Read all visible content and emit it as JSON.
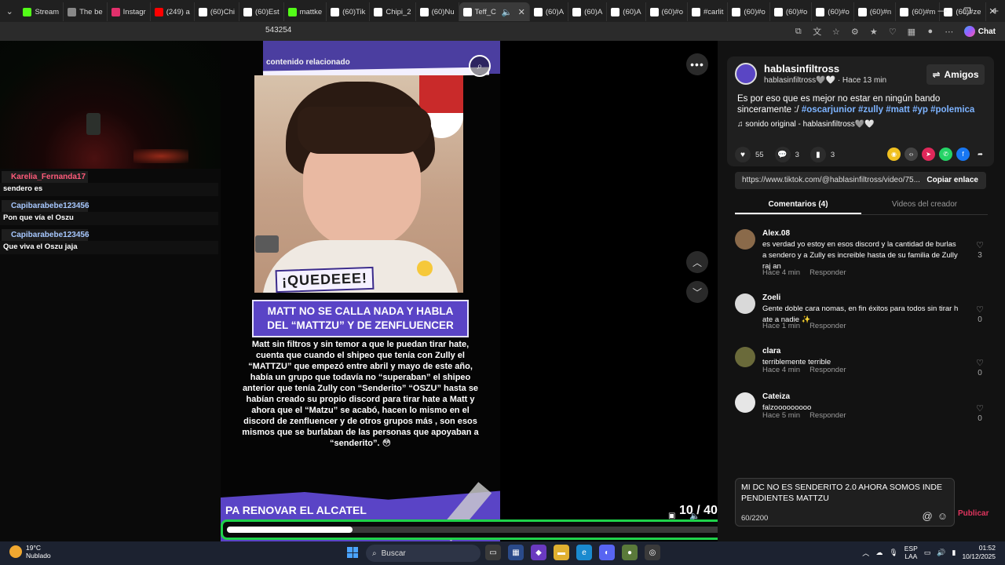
{
  "browser": {
    "tabs": [
      {
        "label": "Stream",
        "color": "#53fc18",
        "active": false
      },
      {
        "label": "The be",
        "color": "#888888",
        "active": false
      },
      {
        "label": "Instagr",
        "color": "#e1306c",
        "active": false
      },
      {
        "label": "(249) a",
        "color": "#ff0000",
        "active": false
      },
      {
        "label": "(60)Chi",
        "color": "#ffffff",
        "active": false
      },
      {
        "label": "(60)Est",
        "color": "#ffffff",
        "active": false
      },
      {
        "label": "mattke",
        "color": "#53fc18",
        "active": false
      },
      {
        "label": "(60)Tik",
        "color": "#ffffff",
        "active": false
      },
      {
        "label": "Chipi_2",
        "color": "#ffffff",
        "active": false
      },
      {
        "label": "(60)Nu",
        "color": "#ffffff",
        "active": false
      },
      {
        "label": "Teff_C",
        "color": "#ffffff",
        "active": true
      },
      {
        "label": "(60)A",
        "color": "#ffffff",
        "active": false
      },
      {
        "label": "(60)A",
        "color": "#ffffff",
        "active": false
      },
      {
        "label": "(60)A",
        "color": "#ffffff",
        "active": false
      },
      {
        "label": "(60)#o",
        "color": "#ffffff",
        "active": false
      },
      {
        "label": "#carlit",
        "color": "#ffffff",
        "active": false
      },
      {
        "label": "(60)#o",
        "color": "#ffffff",
        "active": false
      },
      {
        "label": "(60)#o",
        "color": "#ffffff",
        "active": false
      },
      {
        "label": "(60)#o",
        "color": "#ffffff",
        "active": false
      },
      {
        "label": "(60)#n",
        "color": "#ffffff",
        "active": false
      },
      {
        "label": "(60)#m",
        "color": "#ffffff",
        "active": false
      },
      {
        "label": "(60)#ze",
        "color": "#ffffff",
        "active": false
      }
    ],
    "new_tab": "+",
    "url_fragment": "543254",
    "chat_label": "Chat"
  },
  "stream_chat": {
    "messages": [
      {
        "user": "Karelia_Fernanda17",
        "user_color": "#ff5b7a",
        "text": "sendero es"
      },
      {
        "user": "Capibarabebe123456",
        "user_color": "#a7c8ff",
        "text": "Pon que vía el Oszu"
      },
      {
        "user": "Capibarabebe123456",
        "user_color": "#a7c8ff",
        "text": "Que viva el Oszu jaja"
      }
    ]
  },
  "video": {
    "related_label": "contenido relacionado",
    "sticker_text": "¡QUEDEEE!",
    "headline": "MATT NO SE CALLA NADA Y HABLA DEL “MATTZU” Y DE ZENFLUENCER",
    "body": "Matt sin filtros y sin temor a que le puedan tirar hate, cuenta que cuando el shipeo que tenía con Zully el “MATTZU” que empezó entre abril y mayo de este año, había un grupo que todavía no “superaban” el shipeo anterior que tenía Zully con “Senderito” “OSZU” hasta se habían creado su propio discord para tirar hate a Matt y ahora que el “Matzu” se acabó, hacen lo mismo en el discord de zenfluencer y de otros grupos más , son esos mismos que se burlaban de las personas que apoyaban a “senderito”. 😳",
    "bottom_text": "PA RENOVAR EL ALCATEL",
    "counter": "10 / 40",
    "progress": 0.25
  },
  "post": {
    "creator": "hablasinfiltross",
    "creator_sub": "hablasinfiltross🩶🤍 · Hace 13 min",
    "friends_button": "Amigos",
    "description": "Es por eso que es mejor no estar en ningún bando sinceramente :/",
    "hashtags": "#oscarjunior #zully #matt #yp #polemica",
    "sound": "sonido original - hablasinfiltross🩶🤍",
    "likes": "55",
    "comments_count": "3",
    "saves": "3",
    "link": "https://www.tiktok.com/@hablasinfiltross/video/75...",
    "copy_label": "Copiar enlace",
    "tab_comments": "Comentarios (4)",
    "tab_videos": "Videos del creador"
  },
  "comments": [
    {
      "name": "Alex.08",
      "text": "es verdad yo estoy en esos discord y la cantidad de burlas a sendero y a Zully es increible hasta de su familia de Zully raj an",
      "time": "Hace 4 min",
      "reply": "Responder",
      "likes": "3",
      "avatar_color": "#8a6a4a"
    },
    {
      "name": "Zoeli",
      "text": "Gente doble cara nomas, en fin éxitos para todos sin tirar h ate a nadie ✨",
      "time": "Hace 1 min",
      "reply": "Responder",
      "likes": "0",
      "avatar_color": "#d9d9d9"
    },
    {
      "name": "clara",
      "text": "terriblemente terrible",
      "time": "Hace 4 min",
      "reply": "Responder",
      "likes": "0",
      "avatar_color": "#6a6a3a"
    },
    {
      "name": "Cateiza",
      "text": "falzooooooooo",
      "time": "Hace 5 min",
      "reply": "Responder",
      "likes": "0",
      "avatar_color": "#e6e6e6"
    }
  ],
  "composer": {
    "value": "MI DC NO ES SENDERITO 2.0 AHORA SOMOS INDE PENDIENTES MATTZU",
    "counter": "60/2200",
    "post_label": "Publicar"
  },
  "taskbar": {
    "temp": "19°C",
    "weather": "Nublado",
    "search": "Buscar",
    "lang_1": "ESP",
    "lang_2": "LAA",
    "time": "01:52",
    "date": "10/12/2025"
  }
}
